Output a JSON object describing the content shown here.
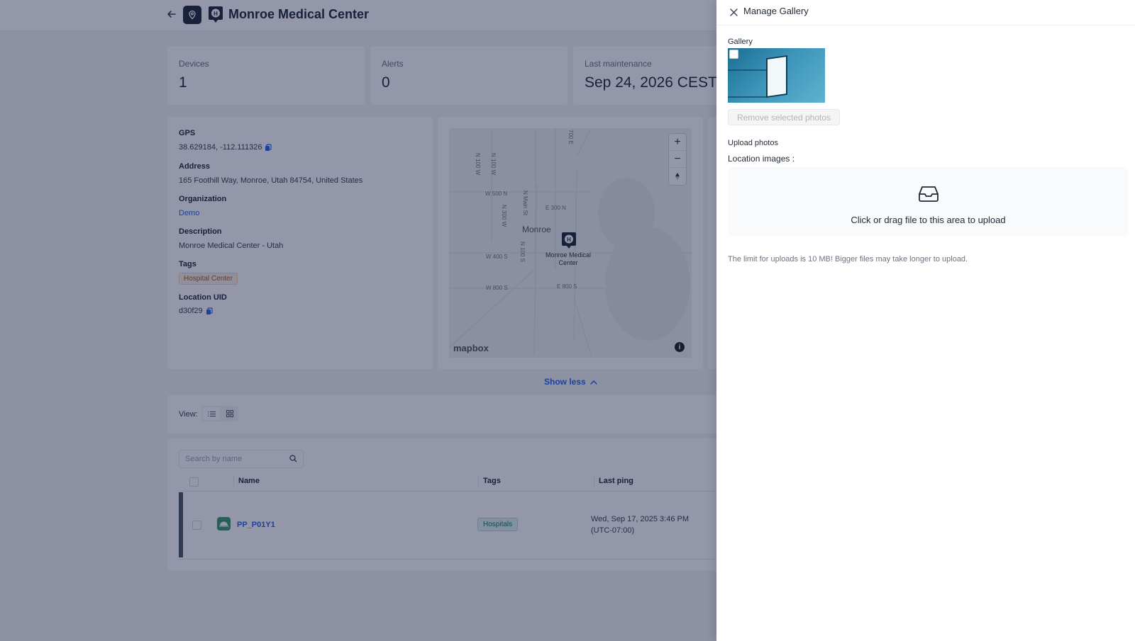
{
  "header": {
    "title": "Monroe Medical Center"
  },
  "stats": [
    {
      "label": "Devices",
      "value": "1"
    },
    {
      "label": "Alerts",
      "value": "0"
    },
    {
      "label": "Last maintenance",
      "value": "Sep 24, 2026 CEST"
    }
  ],
  "details": {
    "gps_label": "GPS",
    "gps_value": "38.629184, -112.111326",
    "address_label": "Address",
    "address_value": "165 Foothill Way, Monroe, Utah 84754, United States",
    "organization_label": "Organization",
    "organization_value": "Demo",
    "description_label": "Description",
    "description_value": "Monroe Medical Center - Utah",
    "tags_label": "Tags",
    "tag_value": "Hospital Center",
    "uid_label": "Location UID",
    "uid_value": "d30f29"
  },
  "map": {
    "town": "Monroe",
    "poi_line1": "Monroe Medical",
    "poi_line2": "Center",
    "streets": [
      "W 500 N",
      "E 300 N",
      "W 400 S",
      "W 800 S",
      "E 800 S",
      "N Main St",
      "N 300 W",
      "N 100 W",
      "N 100 W",
      "700 E",
      "N 100 S"
    ],
    "attribution": "mapbox",
    "zoom_in": "+",
    "zoom_out": "−"
  },
  "show_less": "Show less",
  "view": {
    "label": "View:"
  },
  "devices_table": {
    "search_placeholder": "Search by name",
    "columns": [
      "Name",
      "Tags",
      "Last ping"
    ],
    "rows": [
      {
        "name": "PP_P01Y1",
        "tag": "Hospitals",
        "ping_line1": "Wed, Sep 17, 2025 3:46 PM",
        "ping_line2": "(UTC-07:00)"
      }
    ]
  },
  "drawer": {
    "title": "Manage Gallery",
    "gallery_label": "Gallery",
    "remove_button": "Remove selected photos",
    "upload_label": "Upload photos",
    "location_images_label": "Location images :",
    "upload_text": "Click or drag file to this area to upload",
    "limit_text": "The limit for uploads is 10 MB! Bigger files may take longer to upload."
  },
  "colors": {
    "accent": "#2563eb",
    "overlay": "#101840",
    "device_icon": "#3f9a6b"
  }
}
